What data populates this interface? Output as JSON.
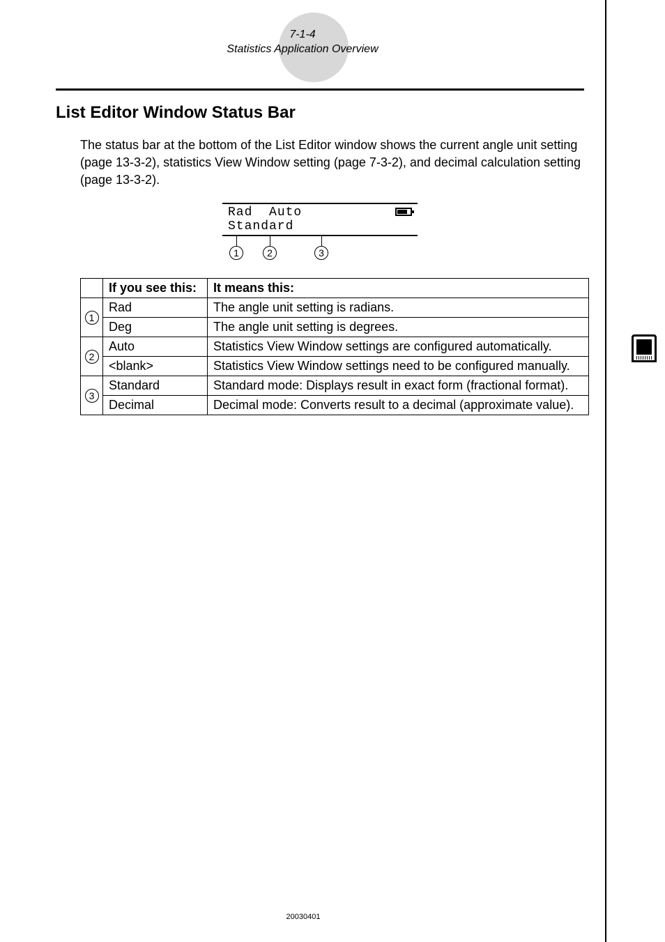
{
  "header": {
    "page_num": "7-1-4",
    "page_title": "Statistics Application Overview"
  },
  "section_title": "List Editor Window Status Bar",
  "intro_text": "The status bar at the bottom of the List Editor window shows the current angle unit setting (page 13-3-2), statistics View Window setting (page 7-3-2), and decimal calculation setting (page 13-3-2).",
  "status_bar": {
    "item1": "Rad",
    "item2": "Auto",
    "item3": "Standard",
    "callout1": "1",
    "callout2": "2",
    "callout3": "3"
  },
  "table": {
    "header_see": "If you see this:",
    "header_means": "It means this:",
    "groups": [
      {
        "num": "1",
        "rows": [
          {
            "see": "Rad",
            "means": "The angle unit setting is radians."
          },
          {
            "see": "Deg",
            "means": "The angle unit setting is degrees."
          }
        ]
      },
      {
        "num": "2",
        "rows": [
          {
            "see": "Auto",
            "means": "Statistics View Window settings are configured automatically."
          },
          {
            "see": "<blank>",
            "means": "Statistics View Window settings need to be configured manually."
          }
        ]
      },
      {
        "num": "3",
        "rows": [
          {
            "see": "Standard",
            "means": "Standard mode: Displays result in exact form (fractional format)."
          },
          {
            "see": "Decimal",
            "means": "Decimal mode: Converts result to a decimal (approximate value)."
          }
        ]
      }
    ]
  },
  "footer_date": "20030401"
}
